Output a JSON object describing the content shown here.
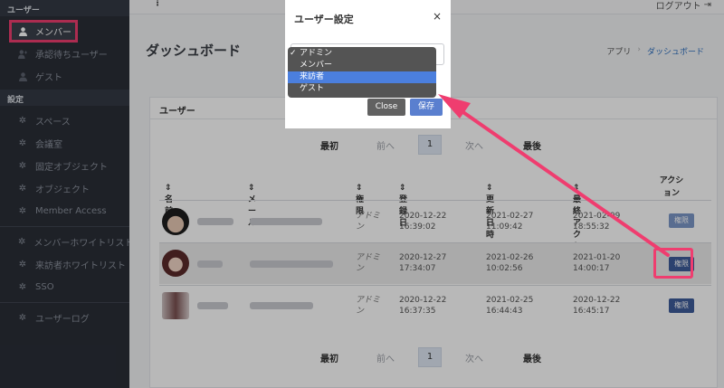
{
  "sidebar": {
    "section_users": "ユーザー",
    "items_users": [
      {
        "label": "メンバー",
        "icon": "person-icon"
      },
      {
        "label": "承認待ちユーザー",
        "icon": "person-add-icon"
      },
      {
        "label": "ゲスト",
        "icon": "person-icon"
      }
    ],
    "section_settings": "設定",
    "items_settings": [
      {
        "label": "スペース",
        "icon": "gear-icon"
      },
      {
        "label": "会議室",
        "icon": "gear-icon"
      },
      {
        "label": "固定オブジェクト",
        "icon": "gear-icon"
      },
      {
        "label": "オブジェクト",
        "icon": "gear-icon"
      },
      {
        "label": "Member Access",
        "icon": "gear-icon"
      }
    ],
    "items_lists": [
      {
        "label": "メンバーホワイトリスト",
        "icon": "gear-icon"
      },
      {
        "label": "来訪者ホワイトリスト",
        "icon": "gear-icon"
      },
      {
        "label": "SSO",
        "icon": "gear-icon"
      }
    ],
    "items_log": [
      {
        "label": "ユーザーログ",
        "icon": "gear-icon"
      }
    ]
  },
  "header": {
    "logout": "ログアウト",
    "page_title": "ダッシュボード",
    "breadcrumb": [
      "アプリ",
      "ダッシュボード"
    ]
  },
  "card": {
    "title": "ユーザー",
    "pager": {
      "first": "最初",
      "prev": "前へ",
      "page": "1",
      "next": "次へ",
      "last": "最後"
    },
    "columns": [
      "名前",
      "メール",
      "権限",
      "登録日",
      "更新日時",
      "最終アクセス",
      "アクション"
    ],
    "rows": [
      {
        "role": "アドミン",
        "registered": "2020-12-22 16:39:02",
        "updated": "2021-02-27 11:09:42",
        "last_access": "2021-02-09 18:55:32",
        "action": "権限"
      },
      {
        "role": "アドミン",
        "registered": "2020-12-27 17:34:07",
        "updated": "2021-02-26 10:02:56",
        "last_access": "2021-01-20 14:00:17",
        "action": "権限"
      },
      {
        "role": "アドミン",
        "registered": "2020-12-22 16:37:35",
        "updated": "2021-02-25 16:44:43",
        "last_access": "2020-12-22 16:45:17",
        "action": "権限"
      }
    ]
  },
  "modal": {
    "title": "ユーザー設定",
    "close_x": "×",
    "options": [
      "アドミン",
      "メンバー",
      "来訪者",
      "ゲスト"
    ],
    "checked_option": "アドミン",
    "highlighted_option": "来訪者",
    "close_button": "Close",
    "save_button": "保存"
  },
  "colors": {
    "sidebar_bg": "#2a2e37",
    "annotation": "#ef3d6f",
    "primary_button": "#3e5c9a",
    "dropdown_highlight": "#4b7fde"
  }
}
